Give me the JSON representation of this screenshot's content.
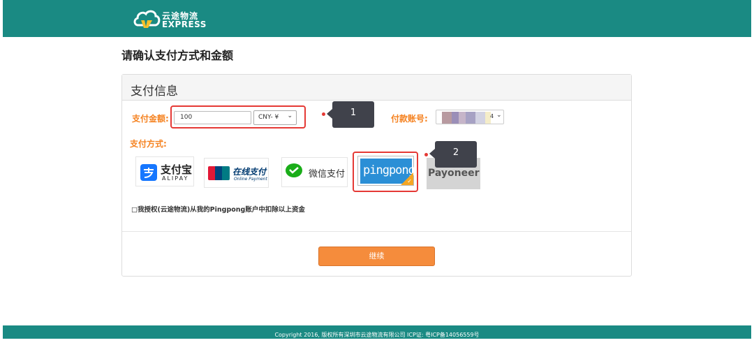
{
  "header": {
    "logo_cn": "云途物流",
    "logo_en": "EXPRESS"
  },
  "page_title": "请确认支付方式和金额",
  "panel": {
    "title": "支付信息",
    "amount_label": "支付金额:",
    "amount_value": "100",
    "currency_selected": "CNY- ¥",
    "account_label": "付款账号:",
    "account_suffix": "4",
    "method_label": "支付方式:",
    "methods": [
      {
        "name": "alipay",
        "label_cn": "支付宝",
        "label_en": "ALIPAY"
      },
      {
        "name": "unionpay",
        "label_cn": "在线支付",
        "label_en": "Online Payment",
        "badge": "UnionPay 银联"
      },
      {
        "name": "wechat",
        "label_cn": "微信支付"
      },
      {
        "name": "pingpong",
        "label": "pingpong",
        "selected": true
      },
      {
        "name": "payoneer",
        "label": "Payoneer"
      }
    ],
    "agree_text": "□我授权(云途物流)从我的Pingpong账户中扣除以上资金",
    "continue_label": "继续"
  },
  "callouts": [
    "1",
    "2"
  ],
  "footer": {
    "text": "Copyright 2016, 版权所有深圳市云途物流有限公司 ICP证: 粤ICP备14056559号"
  },
  "colors": {
    "brand_teal": "#1a8a83",
    "accent_orange": "#f58220",
    "highlight_red": "#e53935",
    "callout_dark": "#40424b"
  }
}
